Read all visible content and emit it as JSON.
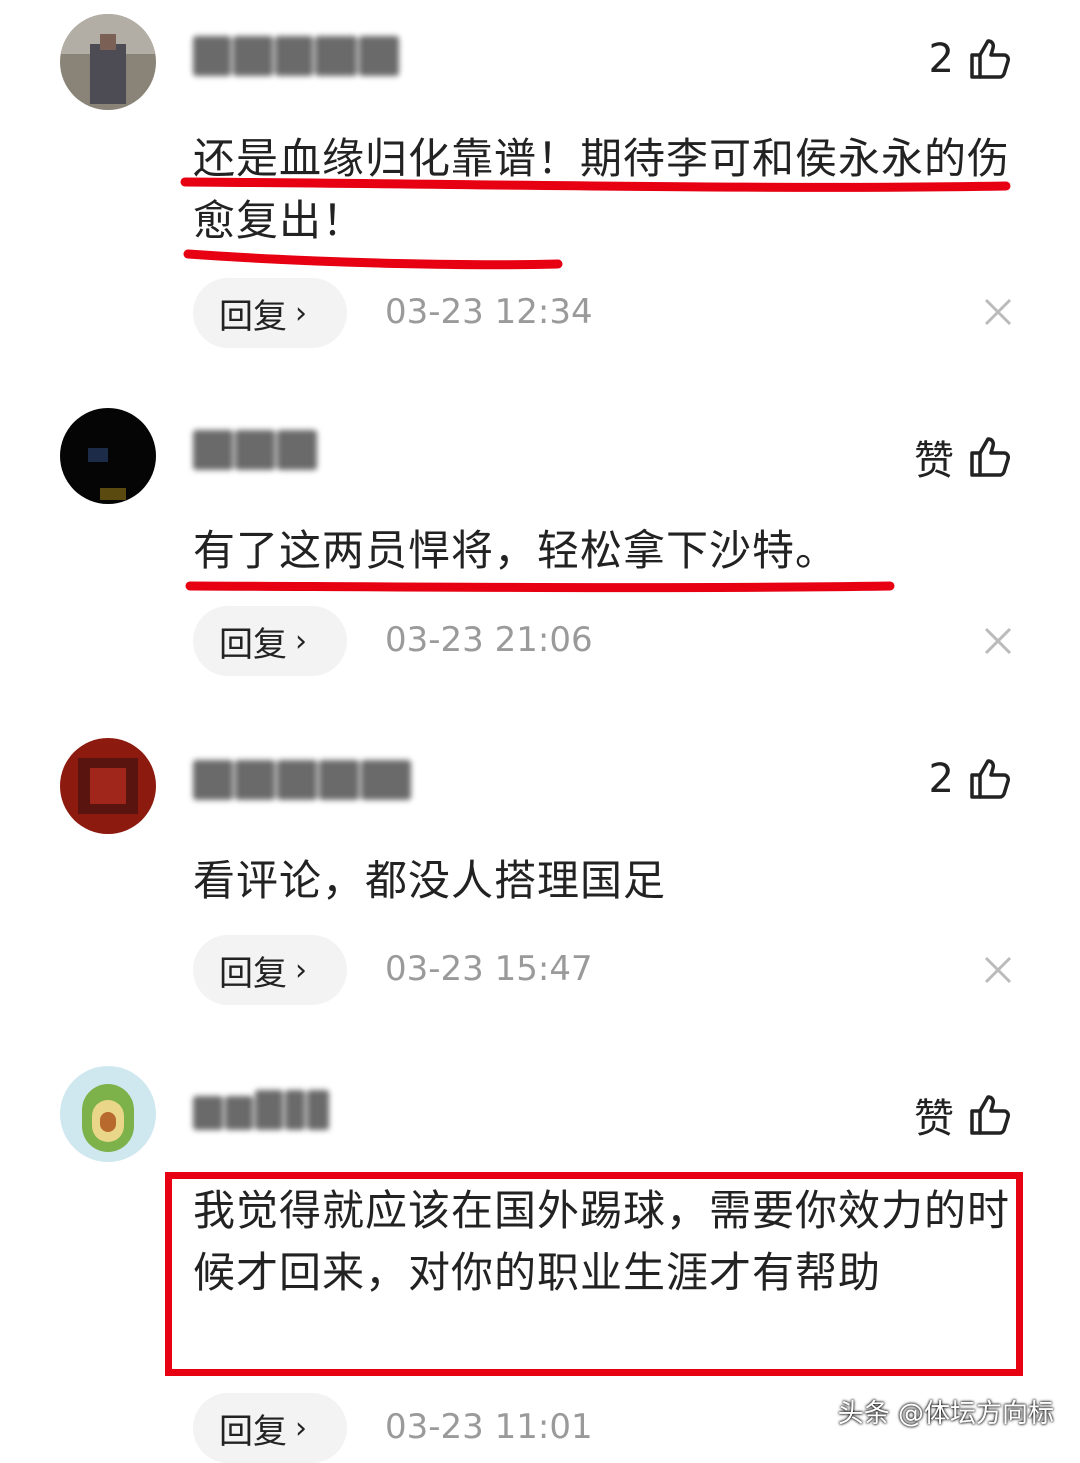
{
  "comments": [
    {
      "likes": "2",
      "text": "还是血缘归化靠谱！期待李可和侯永永的伤愈复出！",
      "reply_label": "回复",
      "time": "03-23 12:34"
    },
    {
      "likes": "赞",
      "text": "有了这两员悍将，轻松拿下沙特。",
      "reply_label": "回复",
      "time": "03-23 21:06"
    },
    {
      "likes": "2",
      "text": "看评论，都没人搭理国足",
      "reply_label": "回复",
      "time": "03-23 15:47"
    },
    {
      "likes": "赞",
      "text": "我觉得就应该在国外踢球，需要你效力的时候才回来，对你的职业生涯才有帮助",
      "reply_label": "回复",
      "time": "03-23 11:01"
    }
  ],
  "watermark": "头条 @体坛方向标",
  "colors": {
    "highlight_red": "#e60012",
    "time_gray": "#9a9a9a",
    "reply_bg": "#f3f3f3"
  }
}
